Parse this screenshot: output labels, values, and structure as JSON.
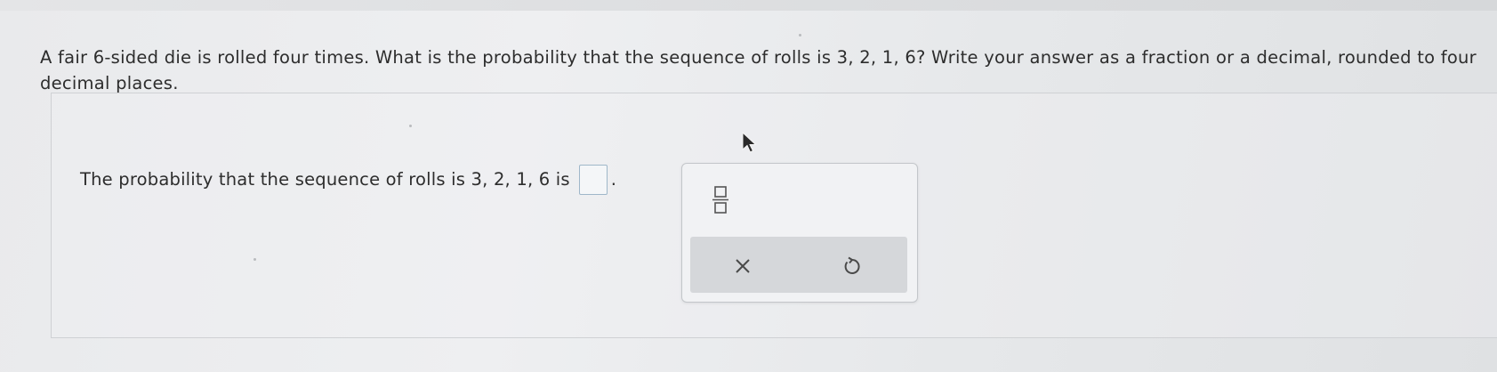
{
  "question": {
    "text": "A fair 6-sided die is rolled four times. What is the probability that the sequence of rolls is 3, 2, 1, 6? Write your answer as a fraction or a decimal, rounded to four decimal places."
  },
  "answer": {
    "statement_prefix": "The probability that the sequence of rolls is 3, 2, 1, 6 is",
    "statement_suffix": ".",
    "input_value": ""
  },
  "palette": {
    "fraction_icon": "fraction-template-icon",
    "clear_icon": "x-icon",
    "undo_icon": "undo-icon"
  },
  "colors": {
    "input_border": "#9fb7c9",
    "action_bar": "#d5d7da",
    "panel_border": "#c3c6ca"
  }
}
